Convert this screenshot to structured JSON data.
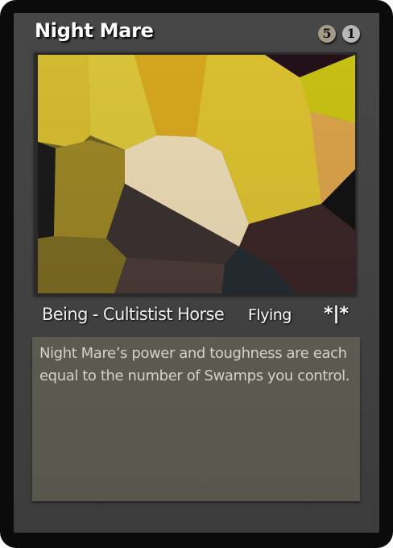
{
  "card": {
    "name": "Night Mare",
    "mana_cost": [
      "5",
      "1"
    ],
    "type_line": "Being - Cultistist Horse",
    "keyword": "Flying",
    "power_toughness": "*|*",
    "rules_text": "Night Mare’s power and toughness are each equal to the number of Swamps you control."
  },
  "colors": {
    "frame": "#444444",
    "border": "#0b0b0b",
    "text_box": "#59594f",
    "generic_mana": "#b6b6b6",
    "colored_mana": "#a59a85"
  }
}
